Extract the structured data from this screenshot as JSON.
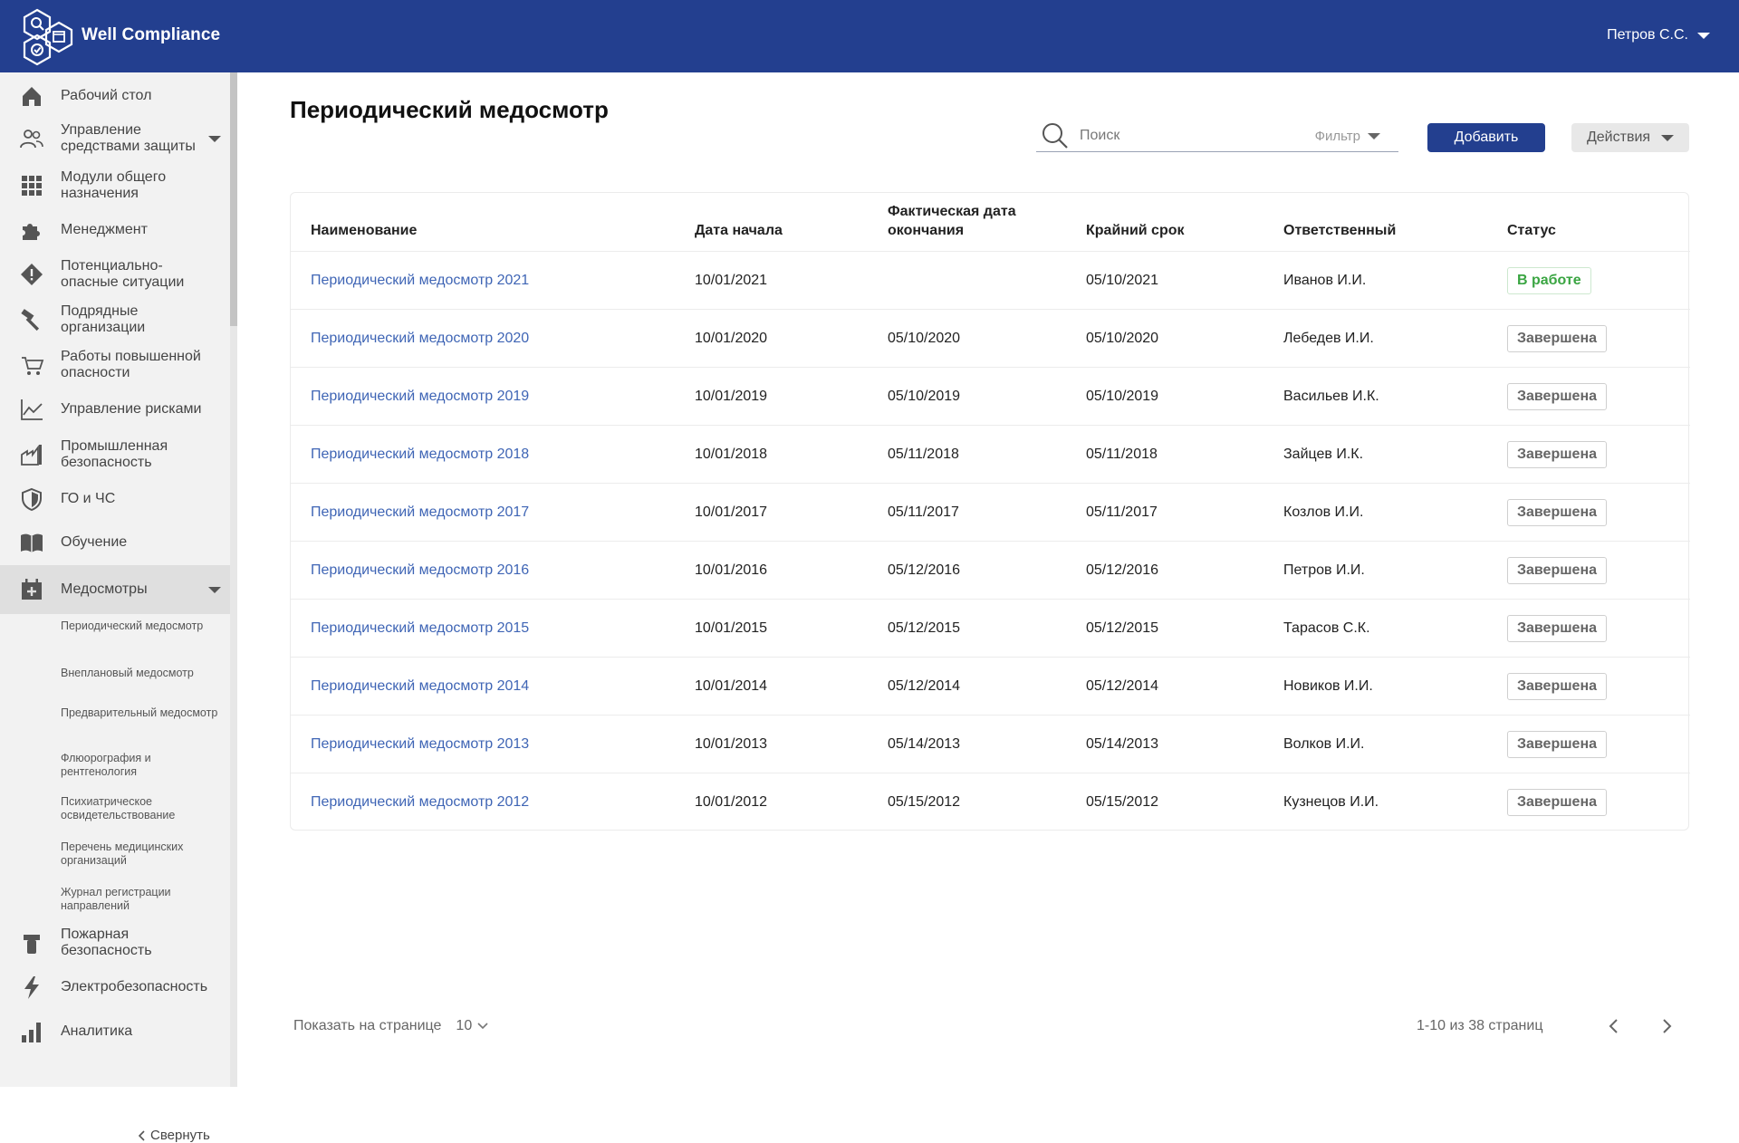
{
  "header": {
    "app_title": "Well Compliance",
    "user_name": "Петров С.С."
  },
  "sidebar": {
    "items": [
      {
        "label": "Рабочий стол",
        "icon": "home-icon"
      },
      {
        "label": "Управление средствами защиты",
        "icon": "users-icon",
        "expandable": true
      },
      {
        "label": "Модули общего назначения",
        "icon": "grid-icon"
      },
      {
        "label": "Менеджмент",
        "icon": "puzzle-icon"
      },
      {
        "label": "Потенциально-опасные ситуации",
        "icon": "warning-icon"
      },
      {
        "label": "Подрядные организации",
        "icon": "hammer-icon"
      },
      {
        "label": "Работы повышенной опасности",
        "icon": "cart-icon"
      },
      {
        "label": "Управление рисками",
        "icon": "chart-line-icon"
      },
      {
        "label": "Промышленная безопасность",
        "icon": "factory-icon"
      },
      {
        "label": "ГО и ЧС",
        "icon": "shield-icon"
      },
      {
        "label": "Обучение",
        "icon": "book-icon"
      },
      {
        "label": "Медосмотры",
        "icon": "medical-calendar-icon",
        "active": true,
        "expandable": true
      },
      {
        "label": "Пожарная безопасность",
        "icon": "fire-extinguisher-icon"
      },
      {
        "label": "Электробезопасность",
        "icon": "lightning-icon"
      },
      {
        "label": "Аналитика",
        "icon": "bar-chart-icon"
      }
    ],
    "sub_items": [
      "Периодический медосмотр",
      "Внеплановый медосмотр",
      "Предварительный медосмотр",
      "Флюорография и рентгенология",
      "Психиатрическое освидетельствование",
      "Перечень медицинских организаций",
      "Журнал регистрации направлений"
    ],
    "collapse_label": "Свернуть"
  },
  "main": {
    "title": "Периодический медосмотр",
    "search_placeholder": "Поиск",
    "filter_label": "Фильтр",
    "add_label": "Добавить",
    "actions_label": "Действия"
  },
  "table": {
    "headers": [
      "Наименование",
      "Дата начала",
      "Фактическая дата окончания",
      "Крайний срок",
      "Ответственный",
      "Статус"
    ],
    "rows": [
      [
        "Периодический медосмотр 2021",
        "10/01/2021",
        "",
        "05/10/2021",
        "Иванов И.И.",
        "В работе"
      ],
      [
        "Периодический медосмотр 2020",
        "10/01/2020",
        "05/10/2020",
        "05/10/2020",
        "Лебедев И.И.",
        "Завершена"
      ],
      [
        "Периодический медосмотр 2019",
        "10/01/2019",
        "05/10/2019",
        "05/10/2019",
        "Васильев И.К.",
        "Завершена"
      ],
      [
        "Периодический медосмотр 2018",
        "10/01/2018",
        "05/11/2018",
        "05/11/2018",
        "Зайцев И.К.",
        "Завершена"
      ],
      [
        "Периодический медосмотр 2017",
        "10/01/2017",
        "05/11/2017",
        "05/11/2017",
        "Козлов И.И.",
        "Завершена"
      ],
      [
        "Периодический медосмотр 2016",
        "10/01/2016",
        "05/12/2016",
        "05/12/2016",
        "Петров И.И.",
        "Завершена"
      ],
      [
        "Периодический медосмотр 2015",
        "10/01/2015",
        "05/12/2015",
        "05/12/2015",
        "Тарасов С.К.",
        "Завершена"
      ],
      [
        "Периодический медосмотр 2014",
        "10/01/2014",
        "05/12/2014",
        "05/12/2014",
        "Новиков И.И.",
        "Завершена"
      ],
      [
        "Периодический медосмотр 2013",
        "10/01/2013",
        "05/14/2013",
        "05/14/2013",
        "Волков И.И.",
        "Завершена"
      ],
      [
        "Периодический медосмотр 2012",
        "10/01/2012",
        "05/15/2012",
        "05/15/2012",
        "Кузнецов И.И.",
        "Завершена"
      ]
    ]
  },
  "pagination": {
    "page_size_label": "Показать на странице",
    "page_size_value": "10",
    "range_text": "1-10 из 38 страниц"
  },
  "colors": {
    "brand": "#233f8f",
    "link": "#3f65b5",
    "status_active": "#3aa542"
  }
}
